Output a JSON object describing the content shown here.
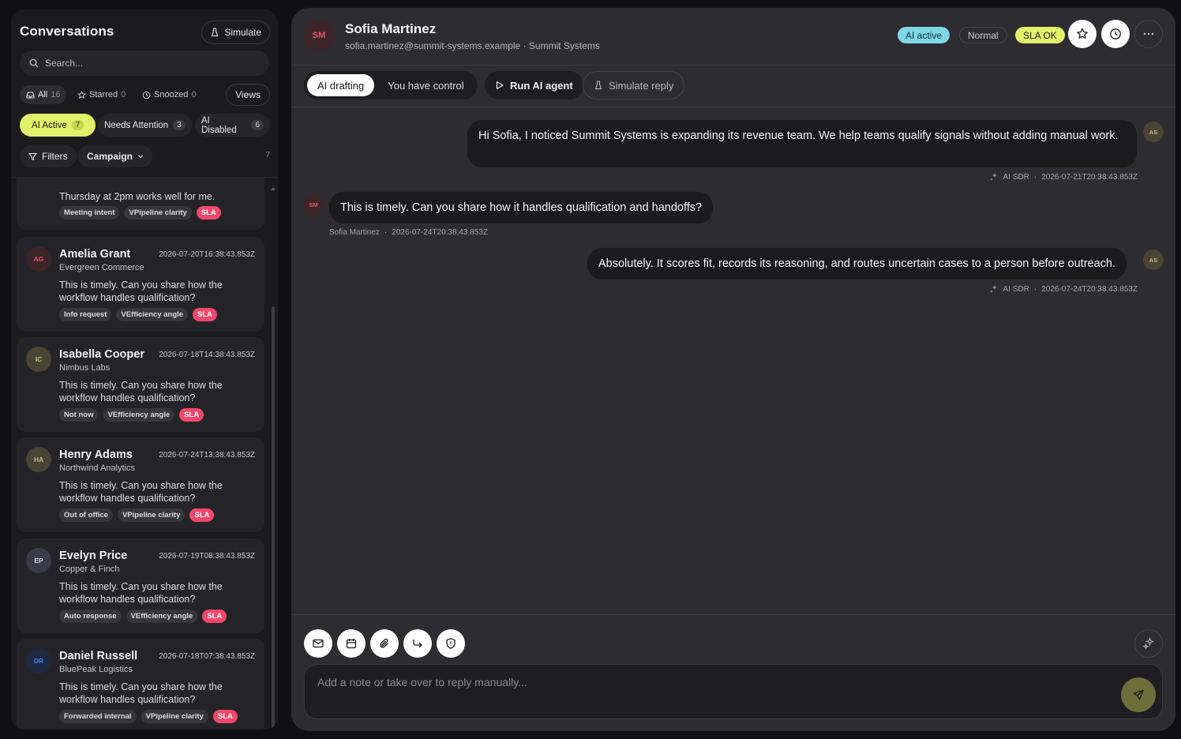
{
  "sidebar": {
    "title": "Conversations",
    "simulate_label": "Simulate",
    "search_placeholder": "Search...",
    "tabs": [
      {
        "label": "All",
        "count": "16"
      },
      {
        "label": "Starred",
        "count": "0"
      },
      {
        "label": "Snoozed",
        "count": "0"
      }
    ],
    "views_label": "Views",
    "status_chips": [
      {
        "label": "AI Active",
        "count": "7"
      },
      {
        "label": "Needs Attention",
        "count": "3"
      },
      {
        "label": "AI Disabled",
        "count": "6"
      }
    ],
    "filters_label": "Filters",
    "campaign_label": "Campaign",
    "result_count": "7",
    "partial_card": {
      "message": "Thursday at 2pm works well for me.",
      "tags": [
        "Meeting intent",
        "VPipeline clarity",
        "SLA"
      ]
    },
    "cards": [
      {
        "initials": "AG",
        "name": "Amelia Grant",
        "timestamp": "2026-07-20T16:38:43.853Z",
        "company": "Evergreen Commerce",
        "message": "This is timely. Can you share how the workflow handles qualification?",
        "tags": [
          "Info request",
          "VEfficiency angle",
          "SLA"
        ],
        "avatar_bg": "#3d2428",
        "avatar_fg": "#e2566a"
      },
      {
        "initials": "IC",
        "name": "Isabella Cooper",
        "timestamp": "2026-07-18T14:38:43.853Z",
        "company": "Nimbus Labs",
        "message": "This is timely. Can you share how the workflow handles qualification?",
        "tags": [
          "Not now",
          "VEfficiency angle",
          "SLA"
        ],
        "avatar_bg": "#4a4434",
        "avatar_fg": "#c9bc8c"
      },
      {
        "initials": "HA",
        "name": "Henry Adams",
        "timestamp": "2026-07-24T13:38:43.853Z",
        "company": "Northwind Analytics",
        "message": "This is timely. Can you share how the workflow handles qualification?",
        "tags": [
          "Out of office",
          "VPipeline clarity",
          "SLA"
        ],
        "avatar_bg": "#4a4434",
        "avatar_fg": "#c9bc8c"
      },
      {
        "initials": "EP",
        "name": "Evelyn Price",
        "timestamp": "2026-07-19T08:38:43.853Z",
        "company": "Copper & Finch",
        "message": "This is timely. Can you share how the workflow handles qualification?",
        "tags": [
          "Auto response",
          "VEfficiency angle",
          "SLA"
        ],
        "avatar_bg": "#3a3a48",
        "avatar_fg": "#d6d6e0"
      },
      {
        "initials": "DR",
        "name": "Daniel Russell",
        "timestamp": "2026-07-18T07:38:43.853Z",
        "company": "BluePeak Logistics",
        "message": "This is timely. Can you share how the workflow handles qualification?",
        "tags": [
          "Forwarded internal",
          "VPipeline clarity",
          "SLA"
        ],
        "avatar_bg": "#1e2840",
        "avatar_fg": "#3f7fe6"
      }
    ]
  },
  "header": {
    "initials": "SM",
    "name": "Sofia Martinez",
    "subtitle": "sofia.martinez@summit-systems.example · Summit Systems",
    "badges": {
      "ai": "AI active",
      "priority": "Normal",
      "sla": "SLA OK"
    }
  },
  "toolbar": {
    "mode_options": [
      "AI drafting",
      "You have control"
    ],
    "run_label": "Run AI agent",
    "simulate_reply_label": "Simulate reply"
  },
  "messages": [
    {
      "from": "agent",
      "text": "Hi Sofia, I noticed Summit Systems is expanding its revenue team. We help teams qualify signals without adding manual work.",
      "sender": "AI SDR",
      "timestamp": "2026-07-21T20:38:43.853Z",
      "avatar": "AS"
    },
    {
      "from": "contact",
      "text": "This is timely. Can you share how it handles qualification and handoffs?",
      "sender": "Sofia Martinez",
      "timestamp": "2026-07-24T20:38:43.853Z",
      "avatar": "SM"
    },
    {
      "from": "agent",
      "text": "Absolutely. It scores fit, records its reasoning, and routes uncertain cases to a person before outreach.",
      "sender": "AI SDR",
      "timestamp": "2026-07-24T20:38:43.853Z",
      "avatar": "AS"
    }
  ],
  "composer": {
    "placeholder": "Add a note or take over to reply manually...",
    "actions": [
      "mail-icon",
      "calendar-icon",
      "paperclip-icon",
      "forward-icon",
      "shield-icon"
    ]
  },
  "colors": {
    "accent_lime": "#dff26a",
    "ai_cyan": "#7fd6e8",
    "sla_red": "#f0476b"
  }
}
